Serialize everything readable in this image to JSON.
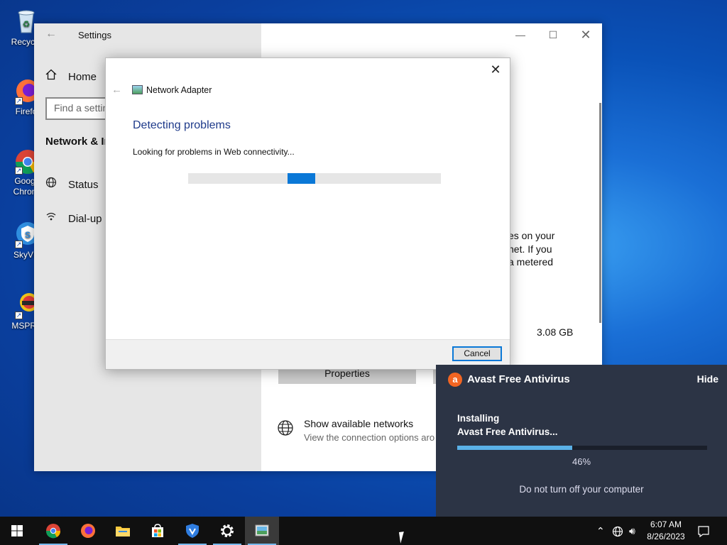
{
  "desktop": {
    "icons": [
      {
        "label": "Recycle Bin",
        "short": "Recycle",
        "icon": "recycle-bin-icon"
      },
      {
        "label": "Firefox",
        "short": "Firefo",
        "icon": "firefox-icon"
      },
      {
        "label": "Google Chrome",
        "short": "Goog Chron",
        "icon": "chrome-icon"
      },
      {
        "label": "SkyVPN",
        "short": "SkyVP",
        "icon": "skyvpn-icon"
      },
      {
        "label": "MSPRe",
        "short": "MSPRe",
        "icon": "mspr-icon"
      }
    ]
  },
  "settings": {
    "title": "Settings",
    "home_label": "Home",
    "search_placeholder": "Find a settin",
    "section_title": "Network & In",
    "nav": [
      {
        "label": "Status",
        "icon": "globe-icon"
      },
      {
        "label": "Dial-up",
        "icon": "dialup-icon"
      }
    ],
    "content_fragment": [
      "es on your",
      "net. If you",
      "a metered"
    ],
    "data_usage": "3.08 GB",
    "properties_label": "Properties",
    "show_networks_title": "Show available networks",
    "show_networks_desc": "View the connection options aro"
  },
  "dialog": {
    "title": "Network Adapter",
    "heading": "Detecting problems",
    "status": "Looking for problems in Web connectivity...",
    "cancel_label": "Cancel"
  },
  "avast": {
    "title": "Avast Free Antivirus",
    "hide_label": "Hide",
    "installing_line1": "Installing",
    "installing_line2": "Avast Free Antivirus...",
    "progress": 0.46,
    "percent_label": "46%",
    "warning": "Do not turn off your computer",
    "colors": {
      "bg": "#2c3445",
      "bar": "#5ab0e6",
      "logo": "#f26522"
    }
  },
  "taskbar": {
    "items": [
      "start",
      "chrome",
      "firefox",
      "file-explorer",
      "microsoft-store",
      "vpn",
      "settings",
      "network-troubleshooter"
    ],
    "time": "6:07 AM",
    "date": "8/26/2023"
  }
}
